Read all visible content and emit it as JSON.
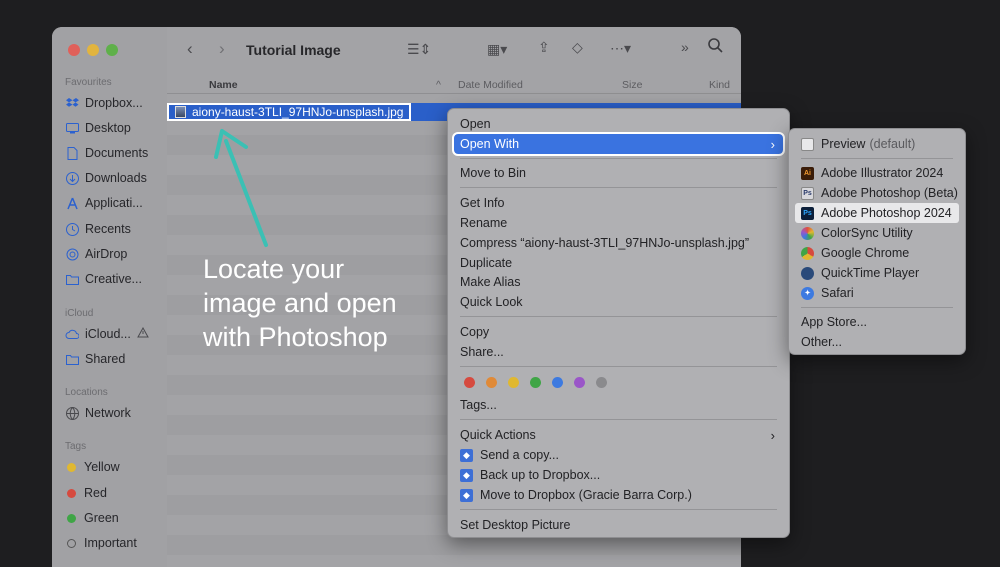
{
  "window": {
    "title": "Tutorial Image"
  },
  "sidebar": {
    "favourites_label": "Favourites",
    "favourites": [
      {
        "label": "Dropbox...",
        "icon": "dropbox-icon"
      },
      {
        "label": "Desktop",
        "icon": "desktop-icon"
      },
      {
        "label": "Documents",
        "icon": "document-icon"
      },
      {
        "label": "Downloads",
        "icon": "download-icon"
      },
      {
        "label": "Applicati...",
        "icon": "applications-icon"
      },
      {
        "label": "Recents",
        "icon": "clock-icon"
      },
      {
        "label": "AirDrop",
        "icon": "airdrop-icon"
      },
      {
        "label": "Creative...",
        "icon": "folder-icon"
      }
    ],
    "icloud_label": "iCloud",
    "icloud": [
      {
        "label": "iCloud...",
        "icon": "cloud-icon"
      },
      {
        "label": "Shared",
        "icon": "shared-folder-icon"
      }
    ],
    "locations_label": "Locations",
    "locations": [
      {
        "label": "Network",
        "icon": "globe-icon"
      }
    ],
    "tags_label": "Tags",
    "tags": [
      {
        "label": "Yellow",
        "color": "#e0b830"
      },
      {
        "label": "Red",
        "color": "#d64a3f"
      },
      {
        "label": "Green",
        "color": "#3fa546"
      },
      {
        "label": "Important",
        "color": "#ffffff"
      }
    ]
  },
  "columns": {
    "name": "Name",
    "date": "Date Modified",
    "size": "Size",
    "kind": "Kind"
  },
  "file": {
    "name": "aiony-haust-3TLI_97HNJo-unsplash.jpg"
  },
  "annotation": {
    "line1": "Locate your",
    "line2": "image and open",
    "line3": "with Photoshop"
  },
  "context_menu": {
    "open": "Open",
    "open_with": "Open With",
    "move_to_bin": "Move to Bin",
    "get_info": "Get Info",
    "rename": "Rename",
    "compress": "Compress “aiony-haust-3TLI_97HNJo-unsplash.jpg”",
    "duplicate": "Duplicate",
    "make_alias": "Make Alias",
    "quick_look": "Quick Look",
    "copy": "Copy",
    "share": "Share...",
    "tags": "Tags...",
    "quick_actions": "Quick Actions",
    "send_copy": "Send a copy...",
    "backup_dropbox": "Back up to Dropbox...",
    "move_dropbox": "Move to Dropbox (Gracie Barra Corp.)",
    "set_desktop": "Set Desktop Picture",
    "tag_colors": [
      "#d64a3f",
      "#e08a38",
      "#e0b830",
      "#3fa546",
      "#3d7ae0",
      "#9a56c8",
      "#8a8a8d"
    ]
  },
  "submenu": {
    "preview": "Preview",
    "preview_default": "(default)",
    "illustrator": "Adobe Illustrator 2024",
    "photoshop_beta": "Adobe Photoshop (Beta)",
    "photoshop_2024": "Adobe Photoshop 2024",
    "colorsync": "ColorSync Utility",
    "chrome": "Google Chrome",
    "quicktime": "QuickTime Player",
    "safari": "Safari",
    "app_store": "App Store...",
    "other": "Other..."
  }
}
